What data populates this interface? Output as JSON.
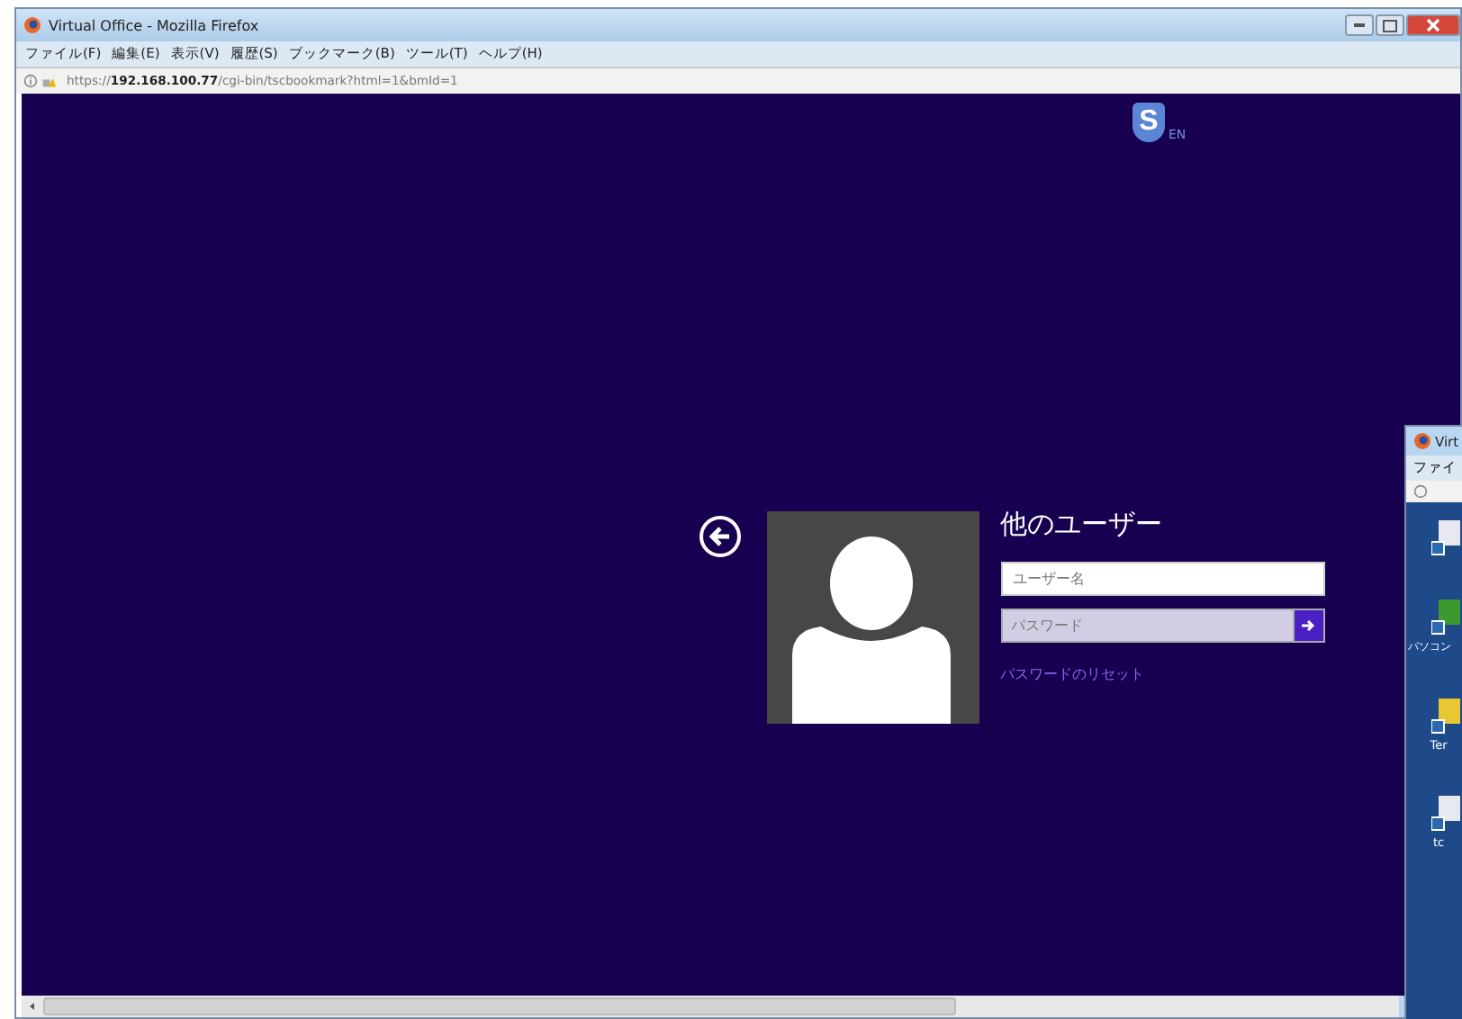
{
  "window": {
    "title": "Virtual Office - Mozilla Firefox"
  },
  "menu": [
    "ファイル(F)",
    "編集(E)",
    "表示(V)",
    "履歴(S)",
    "ブックマーク(B)",
    "ツール(T)",
    "ヘルプ(H)"
  ],
  "address_bar": {
    "url": "https://**192.168.100.77**/cgi-bin/tscbookmark?html=1&bmId=1"
  },
  "logo": {
    "letter": "S",
    "language": "EN"
  },
  "login": {
    "title": "他のユーザー",
    "username": {
      "placeholder": "ユーザー名"
    },
    "password": {
      "placeholder": "パスワード"
    },
    "reset_link": "パスワードのリセット"
  },
  "second_window": {
    "title": "Virt",
    "menu": "ファイ",
    "desktop_icons": [
      {
        "kind": "document"
      },
      {
        "kind": "network",
        "label": "パソコン"
      },
      {
        "kind": "folder",
        "label": "Ter"
      },
      {
        "kind": "document",
        "label": "tc"
      }
    ]
  }
}
